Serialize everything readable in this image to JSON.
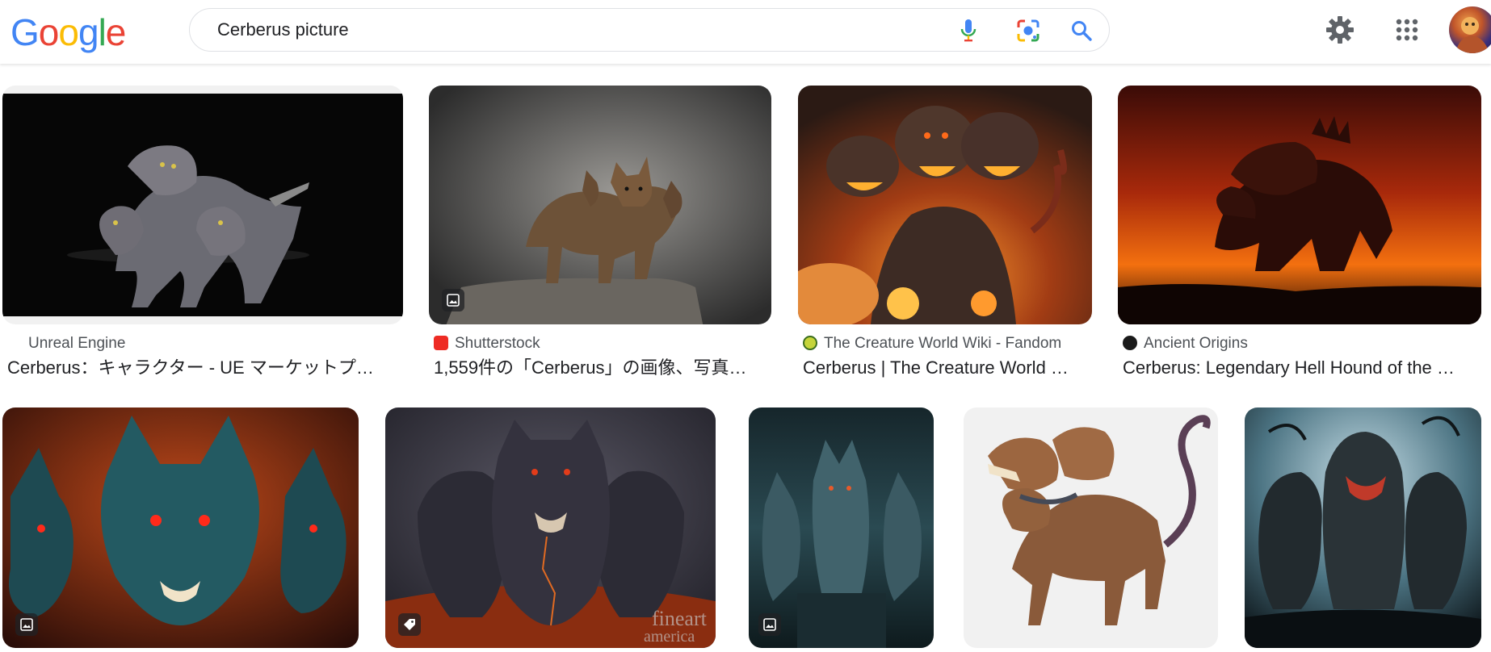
{
  "logo": {
    "letters": [
      "G",
      "o",
      "o",
      "g",
      "l",
      "e"
    ],
    "colors": [
      "#4285F4",
      "#EA4335",
      "#FBBC05",
      "#4285F4",
      "#34A853",
      "#EA4335"
    ]
  },
  "search": {
    "query": "Cerberus picture",
    "icons": [
      "microphone-icon",
      "lens-icon",
      "search-icon"
    ]
  },
  "header_icons": [
    "gear-icon",
    "apps-grid-icon",
    "avatar"
  ],
  "results": [
    {
      "source": "Unreal Engine",
      "title": "Cerberus：キャラクター - UE マーケットプ…",
      "badge": "none"
    },
    {
      "source": "Shutterstock",
      "title": "1,559件の「Cerberus」の画像、写真…",
      "badge": "image-icon"
    },
    {
      "source": "The Creature World Wiki - Fandom",
      "title": "Cerberus | The Creature World …",
      "badge": "none"
    },
    {
      "source": "Ancient Origins",
      "title": "Cerberus: Legendary Hell Hound of the …",
      "badge": "none"
    },
    {
      "source": "",
      "title": "",
      "badge": "image-icon"
    },
    {
      "source": "",
      "title": "",
      "badge": "tag-icon",
      "watermark": "fineart america"
    },
    {
      "source": "",
      "title": "",
      "badge": "image-icon"
    },
    {
      "source": "",
      "title": "",
      "badge": "none"
    },
    {
      "source": "",
      "title": "",
      "badge": "none"
    }
  ],
  "colors": {
    "favicon_shutterstock": "#ee2b24",
    "favicon_fandom": "#c5d43a",
    "favicon_ancient": "#1a1a1a",
    "muted_text": "#4d5156",
    "title_text": "#202124",
    "search_blue": "#4285F4"
  }
}
